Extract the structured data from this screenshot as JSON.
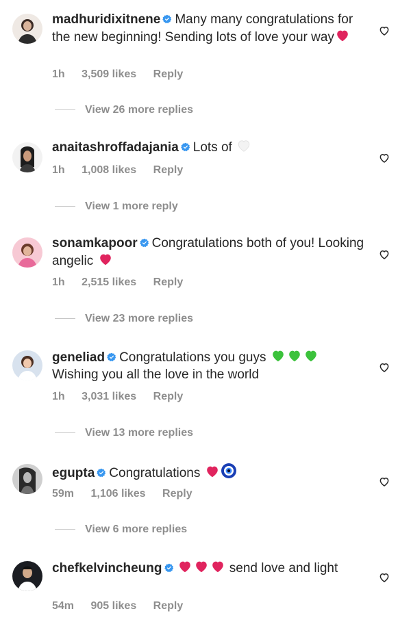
{
  "comments": [
    {
      "username": "madhuridixitnene",
      "text": "Many many congratulations for the new beginning! Sending lots of love your way",
      "emojis": [
        "red-heart"
      ],
      "time": "1h",
      "likes": "3,509 likes",
      "reply": "Reply",
      "view_replies": "View 26 more replies"
    },
    {
      "username": "anaitashroffadajania",
      "text": "Lots of",
      "emojis": [
        "white-heart"
      ],
      "time": "1h",
      "likes": "1,008 likes",
      "reply": "Reply",
      "view_replies": "View 1 more reply"
    },
    {
      "username": "sonamkapoor",
      "text": "Congratulations both of you! Looking angelic",
      "emojis": [
        "red-heart"
      ],
      "time": "1h",
      "likes": "2,515 likes",
      "reply": "Reply",
      "view_replies": "View 23 more replies"
    },
    {
      "username": "geneliad",
      "text": "Congratulations you guys",
      "text2": "Wishing you all the love in the world",
      "emojis": [
        "green-heart",
        "green-heart",
        "green-heart"
      ],
      "time": "1h",
      "likes": "3,031 likes",
      "reply": "Reply",
      "view_replies": "View 13 more replies"
    },
    {
      "username": "egupta",
      "text": "Congratulations",
      "emojis": [
        "red-heart",
        "nazar-amulet"
      ],
      "time": "59m",
      "likes": "1,106 likes",
      "reply": "Reply",
      "view_replies": "View 6 more replies"
    },
    {
      "username": "chefkelvincheung",
      "text": "send love and light",
      "emojis": [
        "red-heart",
        "red-heart",
        "red-heart"
      ],
      "time": "54m",
      "likes": "905 likes",
      "reply": "Reply"
    }
  ],
  "colors": {
    "text": "#262626",
    "meta": "#8e8e8e",
    "verified": "#3897f0",
    "red_heart": "#e0245e",
    "green_heart": "#3cc23c"
  }
}
